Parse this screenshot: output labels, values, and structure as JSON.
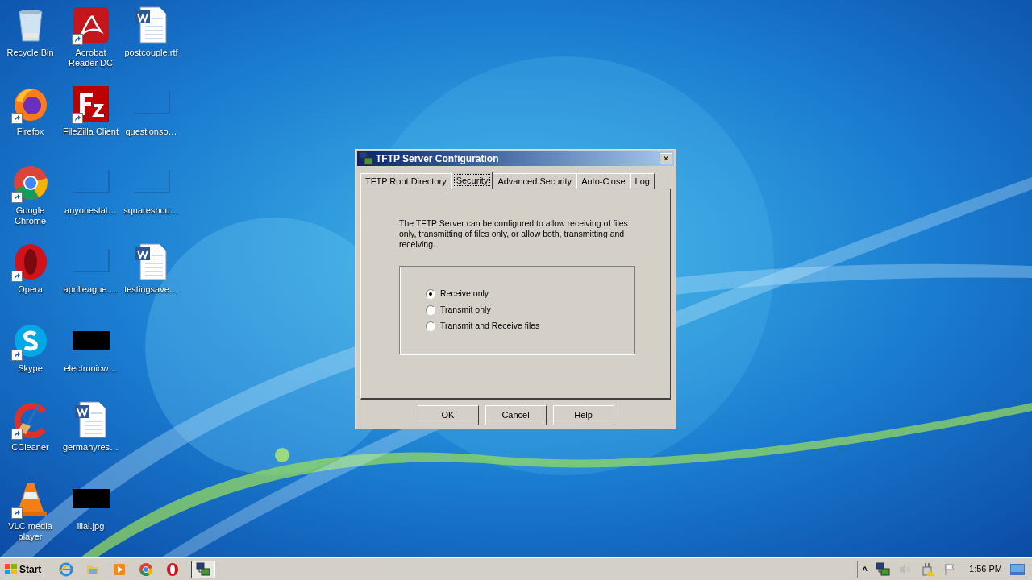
{
  "desktop": {
    "icons": [
      {
        "label": "Recycle Bin",
        "kind": "recycle",
        "shortcut": false
      },
      {
        "label": "Firefox",
        "kind": "firefox",
        "shortcut": true
      },
      {
        "label": "Google Chrome",
        "kind": "chrome",
        "shortcut": true
      },
      {
        "label": "Opera",
        "kind": "opera",
        "shortcut": true
      },
      {
        "label": "Skype",
        "kind": "skype",
        "shortcut": true
      },
      {
        "label": "CCleaner",
        "kind": "ccleaner",
        "shortcut": true
      },
      {
        "label": "VLC media player",
        "kind": "vlc",
        "shortcut": true
      },
      {
        "label": "Acrobat Reader DC",
        "kind": "pdf",
        "shortcut": true
      },
      {
        "label": "FileZilla Client",
        "kind": "filezilla",
        "shortcut": true
      },
      {
        "label": "anyonestat…",
        "kind": "blank",
        "shortcut": false
      },
      {
        "label": "aprilleague.…",
        "kind": "blank",
        "shortcut": false
      },
      {
        "label": "electronicw…",
        "kind": "black",
        "shortcut": false
      },
      {
        "label": "germanyres…",
        "kind": "word",
        "shortcut": false
      },
      {
        "label": "iiial.jpg",
        "kind": "black",
        "shortcut": false
      },
      {
        "label": "postcouple.rtf",
        "kind": "word",
        "shortcut": false
      },
      {
        "label": "questionso…",
        "kind": "blank",
        "shortcut": false
      },
      {
        "label": "squareshou…",
        "kind": "blank",
        "shortcut": false
      },
      {
        "label": "testingsave…",
        "kind": "word",
        "shortcut": false
      }
    ]
  },
  "dialog": {
    "title": "TFTP Server Configuration",
    "close": "×",
    "tabs": [
      {
        "label": "TFTP Root Directory",
        "selected": false
      },
      {
        "label": "Security",
        "selected": true
      },
      {
        "label": "Advanced Security",
        "selected": false
      },
      {
        "label": "Auto-Close",
        "selected": false
      },
      {
        "label": "Log",
        "selected": false
      }
    ],
    "description": "The TFTP Server can be configured to allow receiving of files only, transmitting of files only, or allow both, transmitting and receiving.",
    "options": [
      {
        "label": "Receive only",
        "selected": true
      },
      {
        "label": "Transmit only",
        "selected": false
      },
      {
        "label": "Transmit and Receive files",
        "selected": false
      }
    ],
    "buttons": [
      "OK",
      "Cancel",
      "Help"
    ]
  },
  "taskbar": {
    "start": "Start",
    "quick_launch": [
      {
        "kind": "ie"
      },
      {
        "kind": "folder"
      },
      {
        "kind": "media"
      },
      {
        "kind": "chrome"
      },
      {
        "kind": "opera"
      }
    ],
    "task": {
      "kind": "network",
      "active": true
    },
    "tray": {
      "chevron": "˄",
      "clock": "1:56 PM"
    }
  }
}
